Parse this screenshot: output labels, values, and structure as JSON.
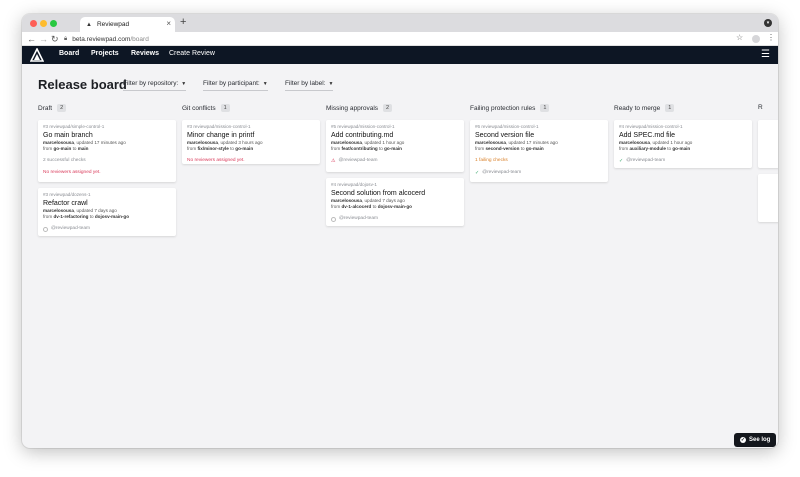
{
  "browser": {
    "tab_title": "Reviewpad",
    "url_host": "beta.reviewpad.com",
    "url_path": "/board"
  },
  "nav": {
    "items": [
      {
        "label": "Board"
      },
      {
        "label": "Projects"
      },
      {
        "label": "Reviews"
      },
      {
        "label": "Create Review"
      }
    ]
  },
  "page": {
    "title": "Release board",
    "filters": [
      {
        "label": "Filter by repository:"
      },
      {
        "label": "Filter by participant:"
      },
      {
        "label": "Filter by label:"
      }
    ]
  },
  "columns": [
    {
      "title": "Draft",
      "count": "2",
      "cards": [
        {
          "repo": "#3 reviewpad/simple-control-1",
          "title": "Go main branch",
          "author": "marcelosousa",
          "updated": ", updated 17 minutes ago",
          "from_word": "from ",
          "from": "go-main",
          "to_word": " to ",
          "to": "main",
          "extra": "2 successful checks",
          "status": "No reviewers assigned yet.",
          "status_type": "red"
        },
        {
          "repo": "#3 reviewpad/dozens-1",
          "title": "Refactor crawl",
          "author": "marcelosousa",
          "updated": ", updated 7 days ago",
          "from_word": "from ",
          "from": "dv-1-refactoring",
          "to_word": " to ",
          "to": "dojosv-main-go",
          "extra": "",
          "status": "@reviewpad-team",
          "status_type": "ring"
        }
      ]
    },
    {
      "title": "Git conflicts",
      "count": "1",
      "cards": [
        {
          "repo": "#3 reviewpad/mission-control-1",
          "title": "Minor change in printf",
          "author": "marcelosousa",
          "updated": ", updated 3 hours ago",
          "from_word": "from ",
          "from": "fix/minor-style",
          "to_word": " to ",
          "to": "go-main",
          "extra": "",
          "status": "No reviewers assigned yet.",
          "status_type": "red"
        }
      ]
    },
    {
      "title": "Missing approvals",
      "count": "2",
      "cards": [
        {
          "repo": "#5 reviewpad/mission-control-1",
          "title": "Add contributing.md",
          "author": "marcelosousa",
          "updated": ", updated 1 hour ago",
          "from_word": "from ",
          "from": "feat/contributing",
          "to_word": " to ",
          "to": "go-main",
          "extra": "",
          "status": "@reviewpad-team",
          "status_type": "warn"
        },
        {
          "repo": "#4 reviewpad/dojosv-1",
          "title": "Second solution from alcocerd",
          "author": "marcelosousa",
          "updated": ", updated 7 days ago",
          "from_word": "from ",
          "from": "dv-1-alcocerd",
          "to_word": " to ",
          "to": "dojosv-main-go",
          "extra": "",
          "status": "@reviewpad-team",
          "status_type": "ring"
        }
      ]
    },
    {
      "title": "Failing protection rules",
      "count": "1",
      "cards": [
        {
          "repo": "#6 reviewpad/mission-control-1",
          "title": "Second version file",
          "author": "marcelosousa",
          "updated": ", updated 17 minutes ago",
          "from_word": "from ",
          "from": "second-version",
          "to_word": " to ",
          "to": "go-main",
          "extra": "1 failing checks",
          "status": "@reviewpad-team",
          "status_type": "check"
        }
      ]
    },
    {
      "title": "Ready to merge",
      "count": "1",
      "cards": [
        {
          "repo": "#4 reviewpad/mission-control-1",
          "title": "Add SPEC.md file",
          "author": "marcelosousa",
          "updated": ", updated 1 hour ago",
          "from_word": "from ",
          "from": "auxiliary-module",
          "to_word": " to ",
          "to": "go-main",
          "extra": "",
          "status": "@reviewpad-team",
          "status_type": "check"
        }
      ]
    },
    {
      "title": "R",
      "count": "",
      "cards": []
    }
  ],
  "footer": {
    "see_log": "See log"
  },
  "colors": {
    "nav_bg": "#0d1624",
    "alert_red": "#d93a5a",
    "success_green": "#3aa76d"
  }
}
